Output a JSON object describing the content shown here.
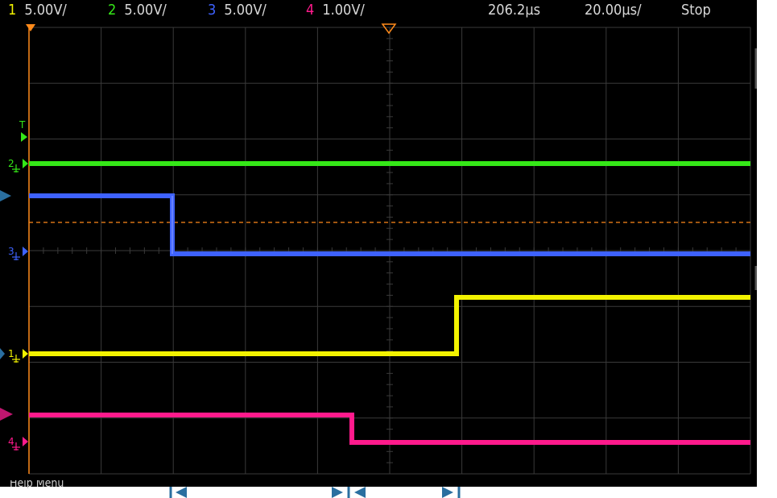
{
  "header": {
    "channels": [
      {
        "number": "1",
        "scale": "5.00V/",
        "color": "#f2f200"
      },
      {
        "number": "2",
        "scale": "5.00V/",
        "color": "#35e818"
      },
      {
        "number": "3",
        "scale": "5.00V/",
        "color": "#3e62ff"
      },
      {
        "number": "4",
        "scale": "1.00V/",
        "color": "#ff1a8c"
      }
    ],
    "delay": "206.2µs",
    "timebase": "20.00µs/",
    "run_state": "Stop"
  },
  "markers": {
    "trigger_label": "T",
    "ch1_label": "1",
    "ch2_label": "2",
    "ch3_label": "3",
    "ch4_label": "4"
  },
  "footer": {
    "softkey_text": "Help Menu"
  },
  "colors": {
    "grid": "#3a3a3a",
    "trigger_marker": "#ff8a1a",
    "annotation": "#2a6fa0"
  }
}
